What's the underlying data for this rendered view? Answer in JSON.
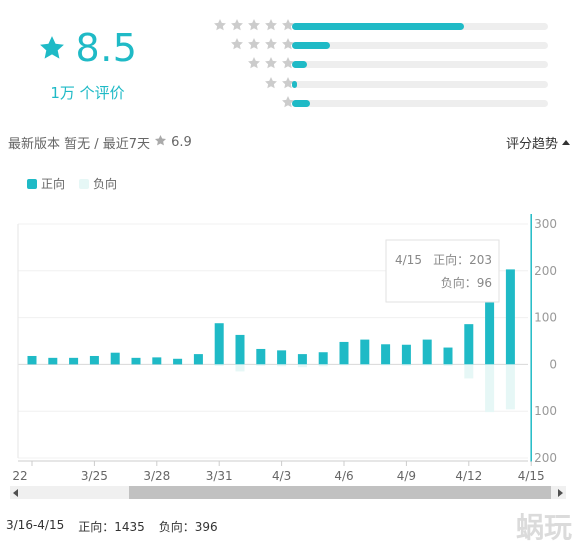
{
  "rating": {
    "score": "8.5",
    "review_count": "1万 个评价",
    "icon": "star-icon",
    "accent_color": "#1fbac6"
  },
  "distribution": [
    {
      "stars": 5,
      "fraction": 0.67
    },
    {
      "stars": 4,
      "fraction": 0.15
    },
    {
      "stars": 3,
      "fraction": 0.06
    },
    {
      "stars": 2,
      "fraction": 0.02
    },
    {
      "stars": 1,
      "fraction": 0.07
    }
  ],
  "info": {
    "latest_version": "最新版本 暂无 / 最近7天",
    "recent_score": "6.9",
    "trend_label": "评分趋势"
  },
  "legend": {
    "positive": "正向",
    "negative": "负向"
  },
  "tooltip": {
    "date": "4/15",
    "positive": "正向：203",
    "negative": "负向：96"
  },
  "footer": {
    "range": "3/16-4/15",
    "positive_total": "正向：1435",
    "negative_total": "负向：396"
  },
  "watermark": "蜗玩",
  "chart_data": {
    "type": "bar",
    "categories": [
      "3/22",
      "3/23",
      "3/24",
      "3/25",
      "3/26",
      "3/27",
      "3/28",
      "3/29",
      "3/30",
      "3/31",
      "4/1",
      "4/2",
      "4/3",
      "4/4",
      "4/5",
      "4/6",
      "4/7",
      "4/8",
      "4/9",
      "4/10",
      "4/11",
      "4/12",
      "4/13",
      "4/14",
      "4/15"
    ],
    "x_tick_labels": [
      "22",
      "3/25",
      "3/28",
      "3/31",
      "4/3",
      "4/6",
      "4/9",
      "4/12",
      "4/15"
    ],
    "series": [
      {
        "name": "正向",
        "color": "#1fbac6",
        "values": [
          18,
          14,
          14,
          18,
          25,
          14,
          15,
          12,
          22,
          88,
          63,
          33,
          30,
          22,
          26,
          48,
          53,
          43,
          42,
          53,
          36,
          86,
          135,
          203
        ]
      },
      {
        "name": "负向",
        "color": "#e6f7f6",
        "values": [
          0,
          0,
          0,
          0,
          0,
          0,
          0,
          0,
          0,
          -3,
          -15,
          -3,
          -4,
          -6,
          -4,
          -2,
          -2,
          -2,
          -3,
          -2,
          -3,
          -30,
          -102,
          -96
        ]
      }
    ],
    "y_ticks": [
      "300",
      "200",
      "100",
      "0",
      "100",
      "200"
    ],
    "ylim": [
      -200,
      300
    ],
    "grid": true,
    "highlight": "4/15"
  }
}
